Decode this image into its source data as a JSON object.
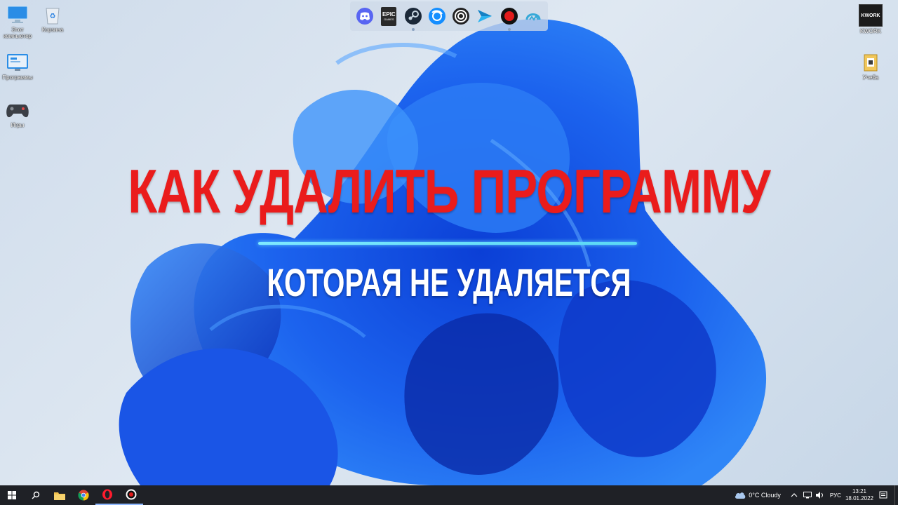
{
  "desktop": {
    "icons_left": [
      {
        "label": "Этот компьютер"
      },
      {
        "label": "Корзина"
      },
      {
        "label": "Программы"
      },
      {
        "label": "Игры"
      }
    ],
    "icons_right": [
      {
        "label": "KWORK",
        "tile_text": "KWORK"
      },
      {
        "label": "Учеба"
      }
    ]
  },
  "overlay": {
    "headline": "КАК УДАЛИТЬ ПРОГРАММУ",
    "subline": "КОТОРАЯ НЕ УДАЛЯЕТСЯ",
    "headline_color": "#ea1c1c",
    "accent_color": "#6fe3ff"
  },
  "dock": {
    "items": [
      {
        "icon": "discord-icon"
      },
      {
        "icon": "epic-games-icon",
        "text_top": "EPIC",
        "text_bottom": "GAMES"
      },
      {
        "icon": "steam-icon"
      },
      {
        "icon": "battlenet-icon"
      },
      {
        "icon": "ubisoft-icon"
      },
      {
        "icon": "arrow-icon"
      },
      {
        "icon": "record-icon"
      },
      {
        "icon": "vpn-icon"
      }
    ]
  },
  "taskbar": {
    "weather": "0°C  Cloudy",
    "language": "РУС",
    "time": "13:21",
    "date": "18.01.2022"
  }
}
